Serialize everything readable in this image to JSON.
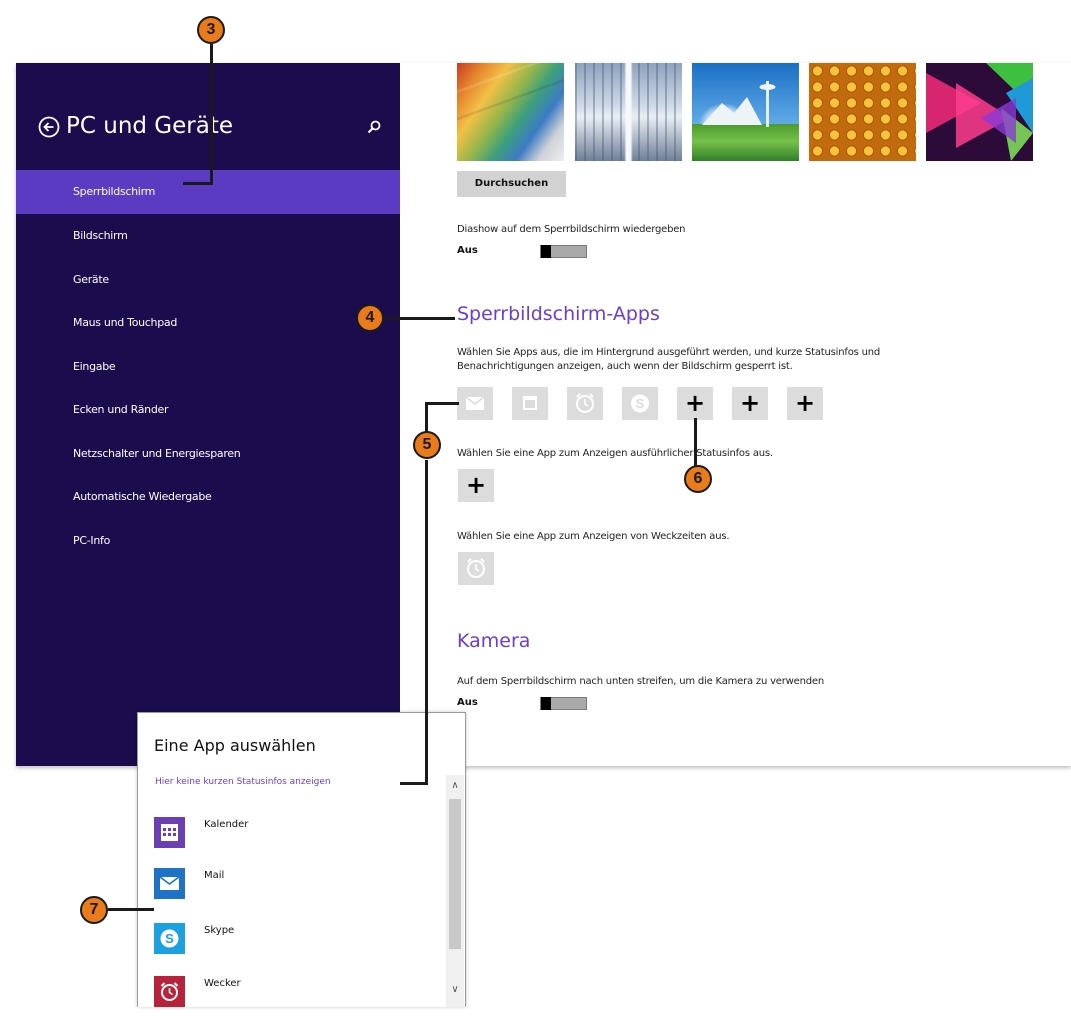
{
  "sidebar": {
    "title": "PC und Geräte",
    "items": [
      {
        "label": "Sperrbildschirm"
      },
      {
        "label": "Bildschirm"
      },
      {
        "label": "Geräte"
      },
      {
        "label": "Maus und Touchpad"
      },
      {
        "label": "Eingabe"
      },
      {
        "label": "Ecken und Ränder"
      },
      {
        "label": "Netzschalter und Energiesparen"
      },
      {
        "label": "Automatische Wiedergabe"
      },
      {
        "label": "PC-Info"
      }
    ],
    "active_index": 0
  },
  "main": {
    "browse_button": "Durchsuchen",
    "slideshow_label": "Diashow auf dem Sperrbildschirm wiedergeben",
    "slideshow_state": "Aus",
    "lock_apps_heading": "Sperrbildschirm-Apps",
    "lock_apps_desc_line1": "Wählen Sie Apps aus, die im Hintergrund ausgeführt werden, und kurze Statusinfos und",
    "lock_apps_desc_line2": "Benachrichtigungen anzeigen, auch wenn der Bildschirm gesperrt ist.",
    "app_slots": [
      "mail-icon",
      "calendar-icon",
      "alarm-icon",
      "skype-icon",
      "plus",
      "plus",
      "plus"
    ],
    "plus_symbol": "+",
    "detailed_label": "Wählen Sie eine App zum Anzeigen ausführlicher Statusinfos aus.",
    "alarm_label": "Wählen Sie eine App zum Anzeigen von Weckzeiten aus.",
    "camera_heading": "Kamera",
    "camera_label": "Auf dem Sperrbildschirm nach unten streifen, um die Kamera zu verwenden",
    "camera_state": "Aus"
  },
  "popup": {
    "title": "Eine App auswählen",
    "link": "Hier keine kurzen Statusinfos anzeigen",
    "apps": [
      {
        "label": "Kalender",
        "icon": "calendar-icon",
        "color": "#6b3fb3"
      },
      {
        "label": "Mail",
        "icon": "mail-icon",
        "color": "#1e72c8"
      },
      {
        "label": "Skype",
        "icon": "skype-icon",
        "color": "#1ba0e0"
      },
      {
        "label": "Wecker",
        "icon": "alarm-icon",
        "color": "#b8223a"
      }
    ]
  },
  "callouts": [
    "3",
    "4",
    "5",
    "6",
    "7"
  ],
  "colors": {
    "sidebar_bg": "#1b0c4d",
    "sidebar_active": "#5b3bc2",
    "accent": "#6a3dd6",
    "callout": "#e97b1b"
  }
}
